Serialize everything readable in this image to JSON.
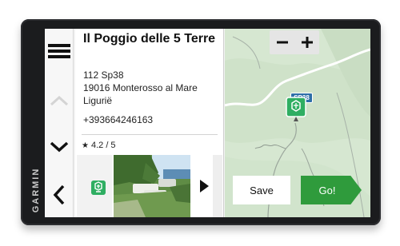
{
  "device": {
    "brand": "GARMIN"
  },
  "nav": {
    "menu_icon": "hamburger-icon",
    "up_icon": "chevron-up-icon",
    "down_icon": "chevron-down-icon",
    "back_icon": "chevron-left-icon"
  },
  "place": {
    "name": "Il Poggio delle 5 Terre",
    "address_line1": "112 Sp38",
    "address_line2": "19016 Monterosso al Mare",
    "address_line3": "Ligurië",
    "phone": "+393664246163",
    "rating": "4.2 / 5"
  },
  "gallery": {
    "badge_icon": "parking-icon",
    "next_icon": "play-right-icon"
  },
  "map": {
    "zoom_out": "−",
    "zoom_in": "+",
    "road_label": "SP38",
    "pin_icon": "campground-pin-icon"
  },
  "actions": {
    "save_label": "Save",
    "go_label": "Go!"
  },
  "colors": {
    "go_green": "#2f9b3c",
    "map_green": "#d7e8d3",
    "road_blue": "#2f6fa8",
    "badge_green": "#2fae62"
  }
}
